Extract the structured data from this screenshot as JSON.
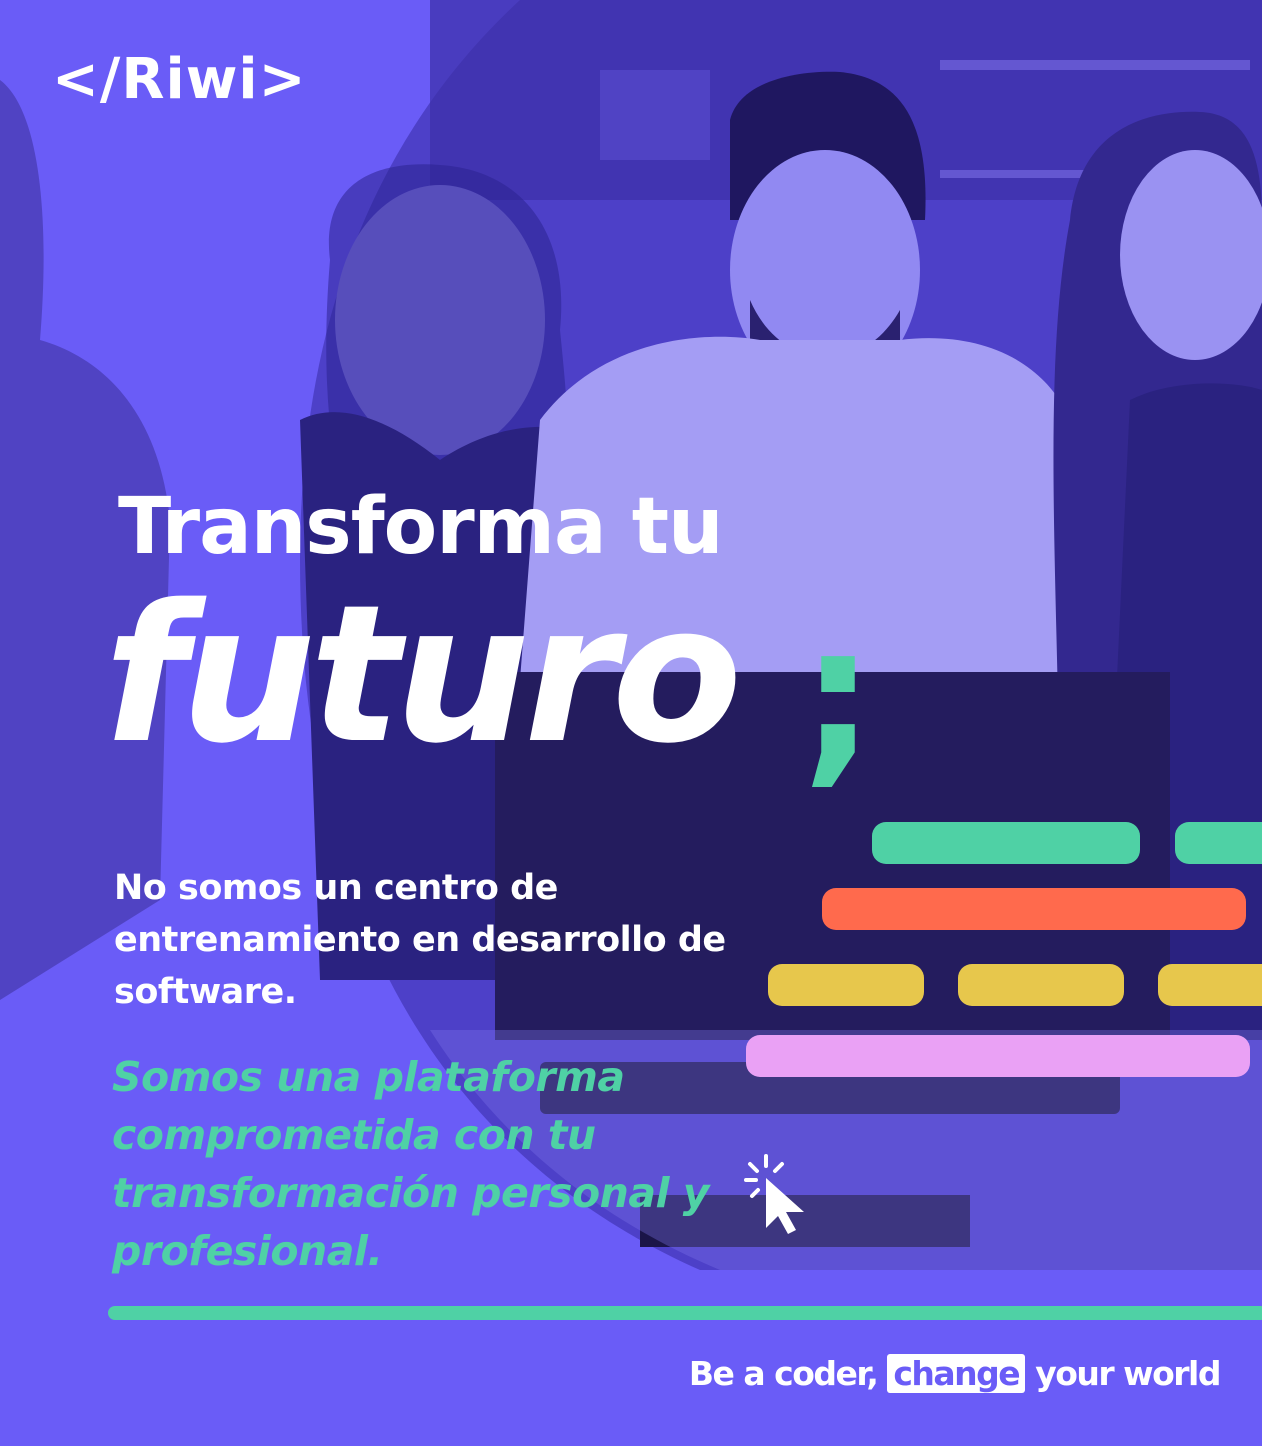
{
  "brand": {
    "logo_text": "</Riwi>"
  },
  "headline": {
    "line1": "Transforma tu",
    "line2": "futuro",
    "punct": ";"
  },
  "body": {
    "intro": "No somos un centro de entrenamiento en desarrollo de software.",
    "statement": "Somos una plataforma comprometida con tu transformación personal y profesional."
  },
  "footer": {
    "tag_before": "Be a coder,",
    "tag_highlight": "change",
    "tag_after": "your world"
  },
  "colors": {
    "background": "#6a5cf7",
    "accent_green": "#4fd1a5",
    "accent_red": "#ff6a4d",
    "accent_yellow": "#e7c74c",
    "accent_pink": "#eaa1f5"
  },
  "icons": {
    "cursor": "click-cursor-icon"
  }
}
